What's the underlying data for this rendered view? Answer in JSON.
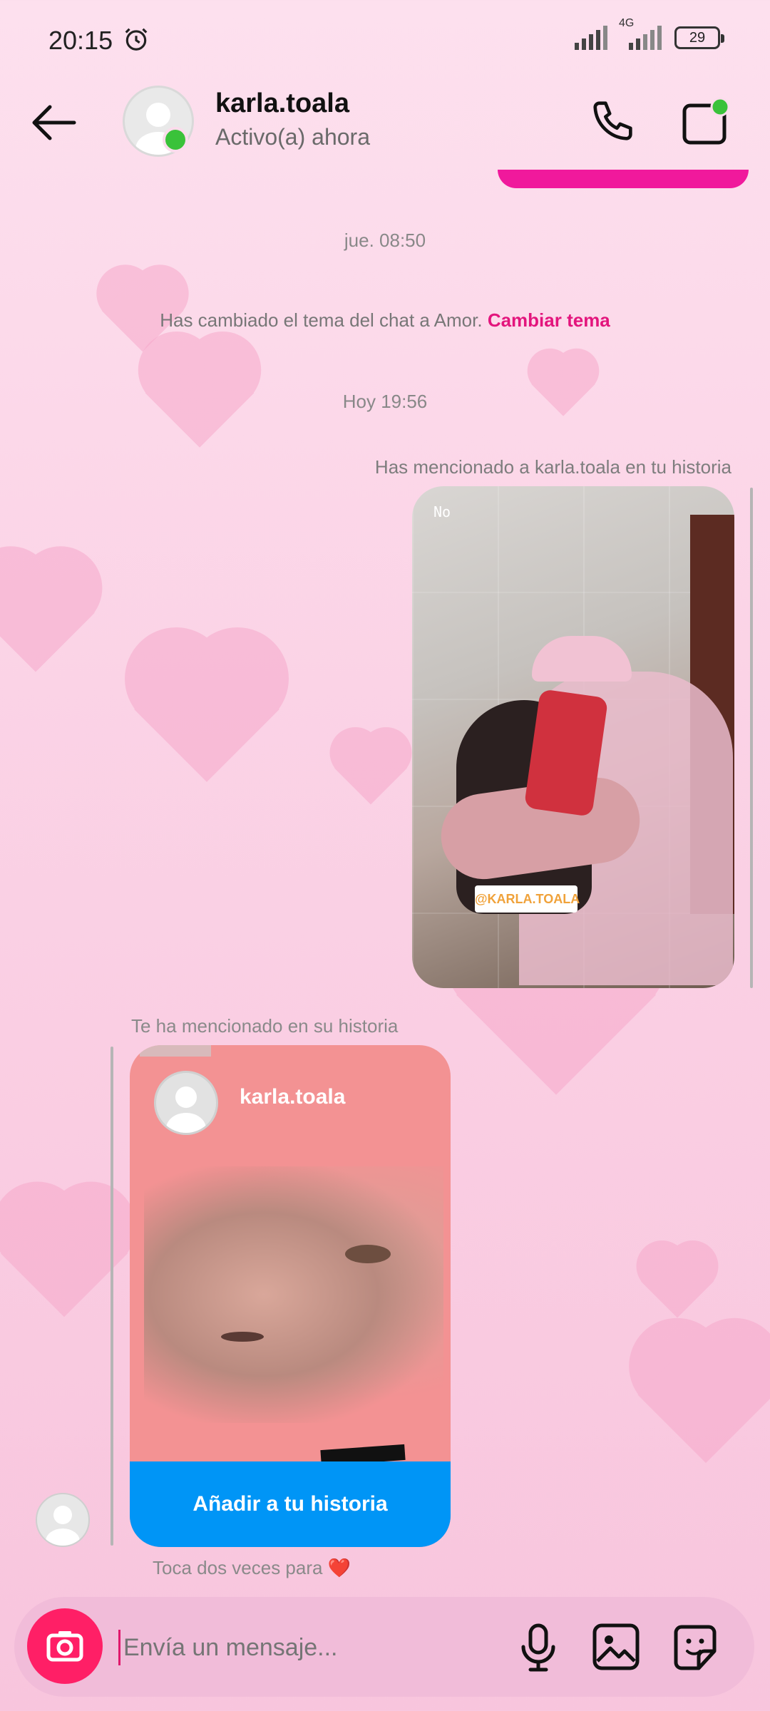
{
  "status_bar": {
    "time": "20:15",
    "network": "4G",
    "battery": "29"
  },
  "header": {
    "name": "karla.toala",
    "status": "Activo(a) ahora",
    "online": true
  },
  "timeline": {
    "date1": "jue. 08:50",
    "theme_message": "Has cambiado el tema del chat a Amor.",
    "theme_action": "Cambiar tema",
    "date2": "Hoy 19:56"
  },
  "sent_story": {
    "caption": "Has mencionado a karla.toala en tu historia",
    "overlay_text": "No",
    "tag": "@KARLA.TOALA"
  },
  "received_story": {
    "caption": "Te ha mencionado en su historia",
    "author": "karla.toala",
    "add_button": "Añadir a tu historia"
  },
  "hint": {
    "text": "Toca dos veces para",
    "emoji": "❤️"
  },
  "composer": {
    "placeholder": "Envía un mensaje..."
  },
  "colors": {
    "accent_pink": "#e3157d",
    "button_blue": "#0095f6",
    "online_green": "#3ac23a",
    "camera_pink": "#ff1f66"
  }
}
